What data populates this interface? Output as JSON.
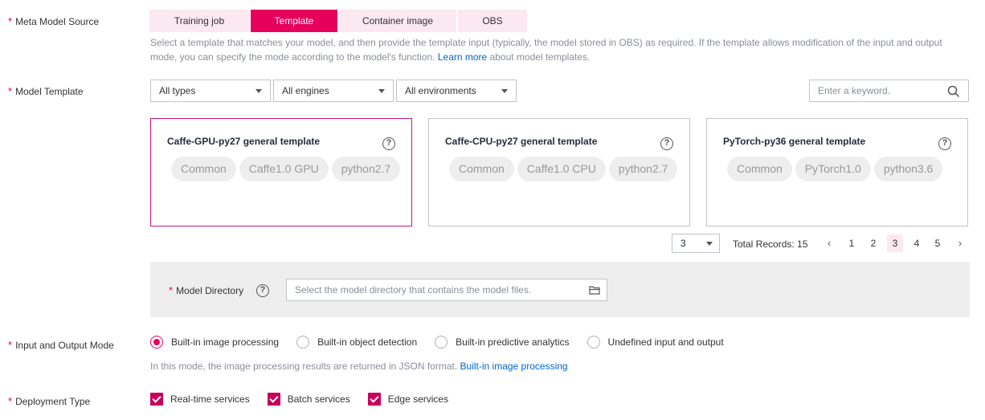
{
  "meta_source": {
    "label": "Meta Model Source",
    "tabs": [
      "Training job",
      "Template",
      "Container image",
      "OBS"
    ],
    "hint_before_link": "Select a template that matches your model, and then provide the template input (typically, the model stored in OBS) as required. If the template allows modification of the input and output mode, you can specify the mode according to the model's function.",
    "hint_link": "Learn more",
    "hint_after_link": "about model templates."
  },
  "model_template": {
    "label": "Model Template",
    "filters": [
      "All types",
      "All engines",
      "All environments"
    ],
    "search_placeholder": "Enter a keyword.",
    "cards": [
      {
        "title": "Caffe-GPU-py27 general template",
        "tags": [
          "Common",
          "Caffe1.0 GPU",
          "python2.7"
        ]
      },
      {
        "title": "Caffe-CPU-py27 general template",
        "tags": [
          "Common",
          "Caffe1.0 CPU",
          "python2.7"
        ]
      },
      {
        "title": "PyTorch-py36 general template",
        "tags": [
          "Common",
          "PyTorch1.0",
          "python3.6"
        ]
      }
    ],
    "pagination": {
      "page_size": "3",
      "total": "Total Records: 15",
      "pages": [
        "1",
        "2",
        "3",
        "4",
        "5"
      ],
      "current": "3"
    }
  },
  "model_directory": {
    "label": "Model Directory",
    "placeholder": "Select the model directory that contains the model files."
  },
  "io_mode": {
    "label": "Input and Output Mode",
    "options": [
      "Built-in image processing",
      "Built-in object detection",
      "Built-in predictive analytics",
      "Undefined input and output"
    ],
    "hint_text": "In this mode, the image processing results are returned in JSON format.",
    "hint_link": "Built-in image processing"
  },
  "deployment": {
    "label": "Deployment Type",
    "options": [
      "Real-time services",
      "Batch services",
      "Edge services"
    ]
  },
  "colors": {
    "accent": "#e6005c",
    "accent_light": "#fce8f0",
    "link": "#0066cc"
  }
}
